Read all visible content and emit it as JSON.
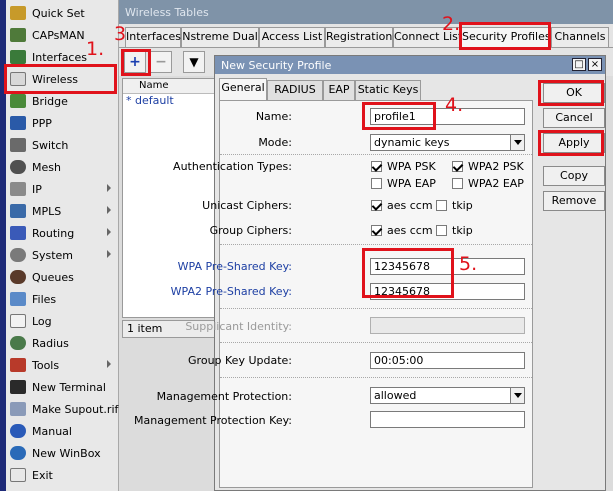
{
  "sidebar": {
    "items": [
      {
        "label": "Quick Set",
        "icon": "quick-set-icon",
        "arrow": false
      },
      {
        "label": "CAPsMAN",
        "icon": "capsman-icon",
        "arrow": false
      },
      {
        "label": "Interfaces",
        "icon": "interfaces-icon",
        "arrow": false
      },
      {
        "label": "Wireless",
        "icon": "wireless-icon",
        "arrow": false
      },
      {
        "label": "Bridge",
        "icon": "bridge-icon",
        "arrow": false
      },
      {
        "label": "PPP",
        "icon": "ppp-icon",
        "arrow": false
      },
      {
        "label": "Switch",
        "icon": "switch-icon",
        "arrow": false
      },
      {
        "label": "Mesh",
        "icon": "mesh-icon",
        "arrow": false
      },
      {
        "label": "IP",
        "icon": "ip-icon",
        "arrow": true
      },
      {
        "label": "MPLS",
        "icon": "mpls-icon",
        "arrow": true
      },
      {
        "label": "Routing",
        "icon": "routing-icon",
        "arrow": true
      },
      {
        "label": "System",
        "icon": "system-icon",
        "arrow": true
      },
      {
        "label": "Queues",
        "icon": "queues-icon",
        "arrow": false
      },
      {
        "label": "Files",
        "icon": "files-icon",
        "arrow": false
      },
      {
        "label": "Log",
        "icon": "log-icon",
        "arrow": false
      },
      {
        "label": "Radius",
        "icon": "radius-icon",
        "arrow": false
      },
      {
        "label": "Tools",
        "icon": "tools-icon",
        "arrow": true
      },
      {
        "label": "New Terminal",
        "icon": "terminal-icon",
        "arrow": false
      },
      {
        "label": "Make Supout.rif",
        "icon": "supout-icon",
        "arrow": false
      },
      {
        "label": "Manual",
        "icon": "manual-icon",
        "arrow": false
      },
      {
        "label": "New WinBox",
        "icon": "winbox-icon",
        "arrow": false
      },
      {
        "label": "Exit",
        "icon": "exit-icon",
        "arrow": false
      }
    ]
  },
  "wireless_tables": {
    "title": "Wireless Tables",
    "tabs": [
      "Interfaces",
      "Nstreme Dual",
      "Access List",
      "Registration",
      "Connect List",
      "Security Profiles",
      "Channels"
    ],
    "table": {
      "column": "Name",
      "rows": [
        {
          "marker": "*",
          "name": "default"
        }
      ]
    },
    "count": "1 item"
  },
  "dialog": {
    "title": "New Security Profile",
    "tabs": [
      "General",
      "RADIUS",
      "EAP",
      "Static Keys"
    ],
    "fields": {
      "name_label": "Name:",
      "name_value": "profile1",
      "mode_label": "Mode:",
      "mode_value": "dynamic keys",
      "auth_label": "Authentication Types:",
      "auth_options": [
        "WPA PSK",
        "WPA2 PSK",
        "WPA EAP",
        "WPA2 EAP"
      ],
      "unicast_label": "Unicast Ciphers:",
      "group_label": "Group Ciphers:",
      "cipher_options": [
        "aes ccm",
        "tkip"
      ],
      "wpa_psk_label": "WPA Pre-Shared Key:",
      "wpa_psk_value": "12345678",
      "wpa2_psk_label": "WPA2 Pre-Shared Key:",
      "wpa2_psk_value": "12345678",
      "supplicant_label": "Supplicant Identity:",
      "supplicant_value": "",
      "group_key_label": "Group Key Update:",
      "group_key_value": "00:05:00",
      "mgmt_protection_label": "Management Protection:",
      "mgmt_protection_value": "allowed",
      "mgmt_key_label": "Management Protection Key:",
      "mgmt_key_value": ""
    },
    "buttons": [
      "OK",
      "Cancel",
      "Apply",
      "Copy",
      "Remove"
    ]
  },
  "annotations": [
    "1.",
    "2.",
    "3",
    "4.",
    "5."
  ],
  "colors": {
    "annotation_red": "#e0121b",
    "title_bar": "#7a92b4",
    "link_blue": "#1d3fa3",
    "taskbar_blue": "#1e2a78"
  }
}
